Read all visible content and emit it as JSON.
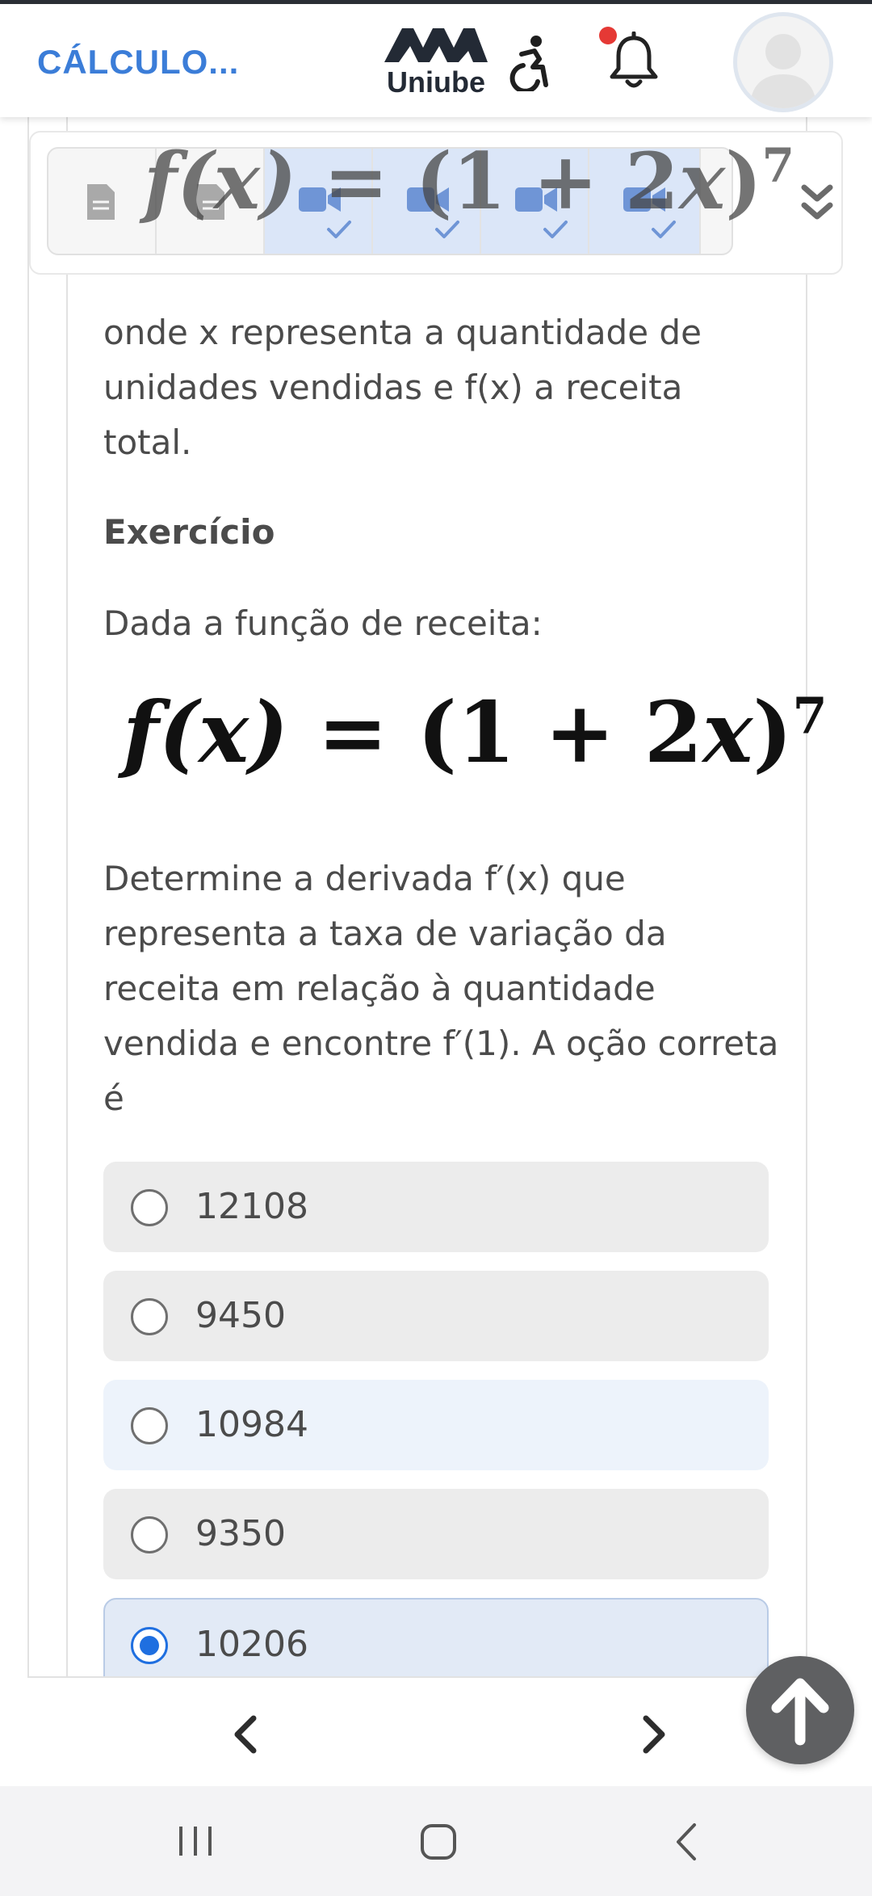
{
  "header": {
    "course_title": "CÁLCULO...",
    "logo_text": "Uniube",
    "logo_mark": "AVA"
  },
  "toolbar": {
    "formula": {
      "lhs": "f(x)",
      "eq": "=",
      "rhs_open": "(1 + 2",
      "var": "x",
      "rhs_close": ")",
      "exp": "7"
    }
  },
  "content": {
    "intro_text": "onde x representa a quantidade de unidades vendidas e f(x) a receita total.",
    "heading": "Exercício",
    "given_text": "Dada a função de receita:",
    "formula": {
      "lhs": "f(x)",
      "eq": "=",
      "rhs_open": "(1 + 2",
      "var": "x",
      "rhs_close": ")",
      "exp": "7"
    },
    "question_text": "Determine a derivada f′(x) que representa a taxa de variação da receita em relação à quantidade vendida e encontre f′(1). A oção correta é"
  },
  "options": [
    {
      "label": "12108",
      "selected": false
    },
    {
      "label": "9450",
      "selected": false
    },
    {
      "label": "10984",
      "selected": false
    },
    {
      "label": "9350",
      "selected": false
    },
    {
      "label": "10206",
      "selected": true
    }
  ],
  "colors": {
    "accent": "#3b7dd8",
    "radio_selected": "#1f6fe0",
    "notification_dot": "#e53935"
  },
  "icons": [
    "accessibility-icon",
    "bell-icon",
    "avatar-icon",
    "document-icon",
    "video-icon",
    "check-icon",
    "double-chevron-down-icon",
    "chevron-left-icon",
    "chevron-right-icon",
    "arrow-up-icon",
    "recents-icon",
    "home-icon",
    "back-icon"
  ]
}
